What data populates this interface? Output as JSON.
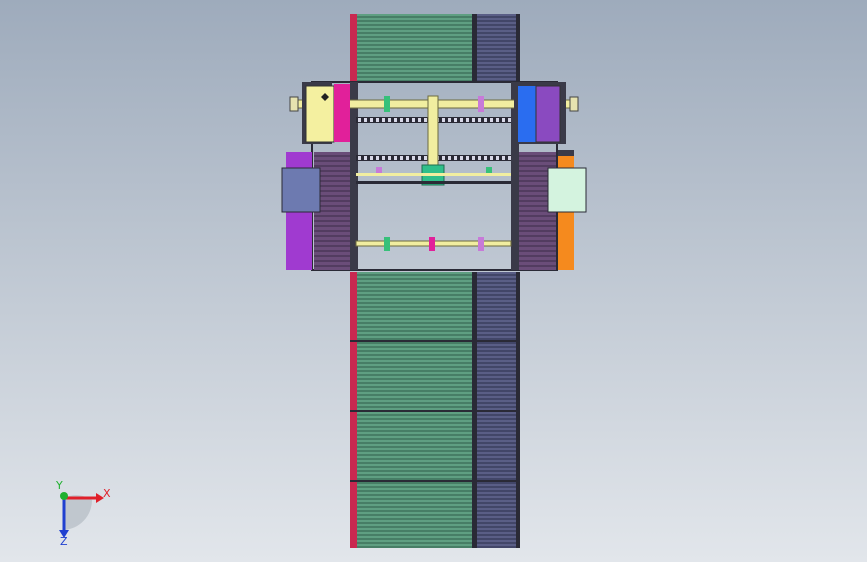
{
  "viewport": {
    "background_top": "#9eabbc",
    "background_bottom": "#e2e6eb"
  },
  "triad": {
    "x_label": "X",
    "y_label": "Y",
    "z_label": "Z",
    "x_color": "#e0202a",
    "y_color": "#20b030",
    "z_color": "#2040d0"
  },
  "colors": {
    "roller_green": "#5f9f82",
    "roller_blue": "#5a5e86",
    "rail_red": "#c92850",
    "frame_yellow": "#f1eea0",
    "magenta": "#e1209a",
    "purple": "#a03ad0",
    "orange": "#f58a1e",
    "blue_box": "#6d7ab0",
    "mint_box": "#d4f3df",
    "teal": "#2fbf8a",
    "bright_blue": "#2a6df0",
    "violet": "#8a4ac0",
    "dark_frame": "#2a2a36"
  }
}
